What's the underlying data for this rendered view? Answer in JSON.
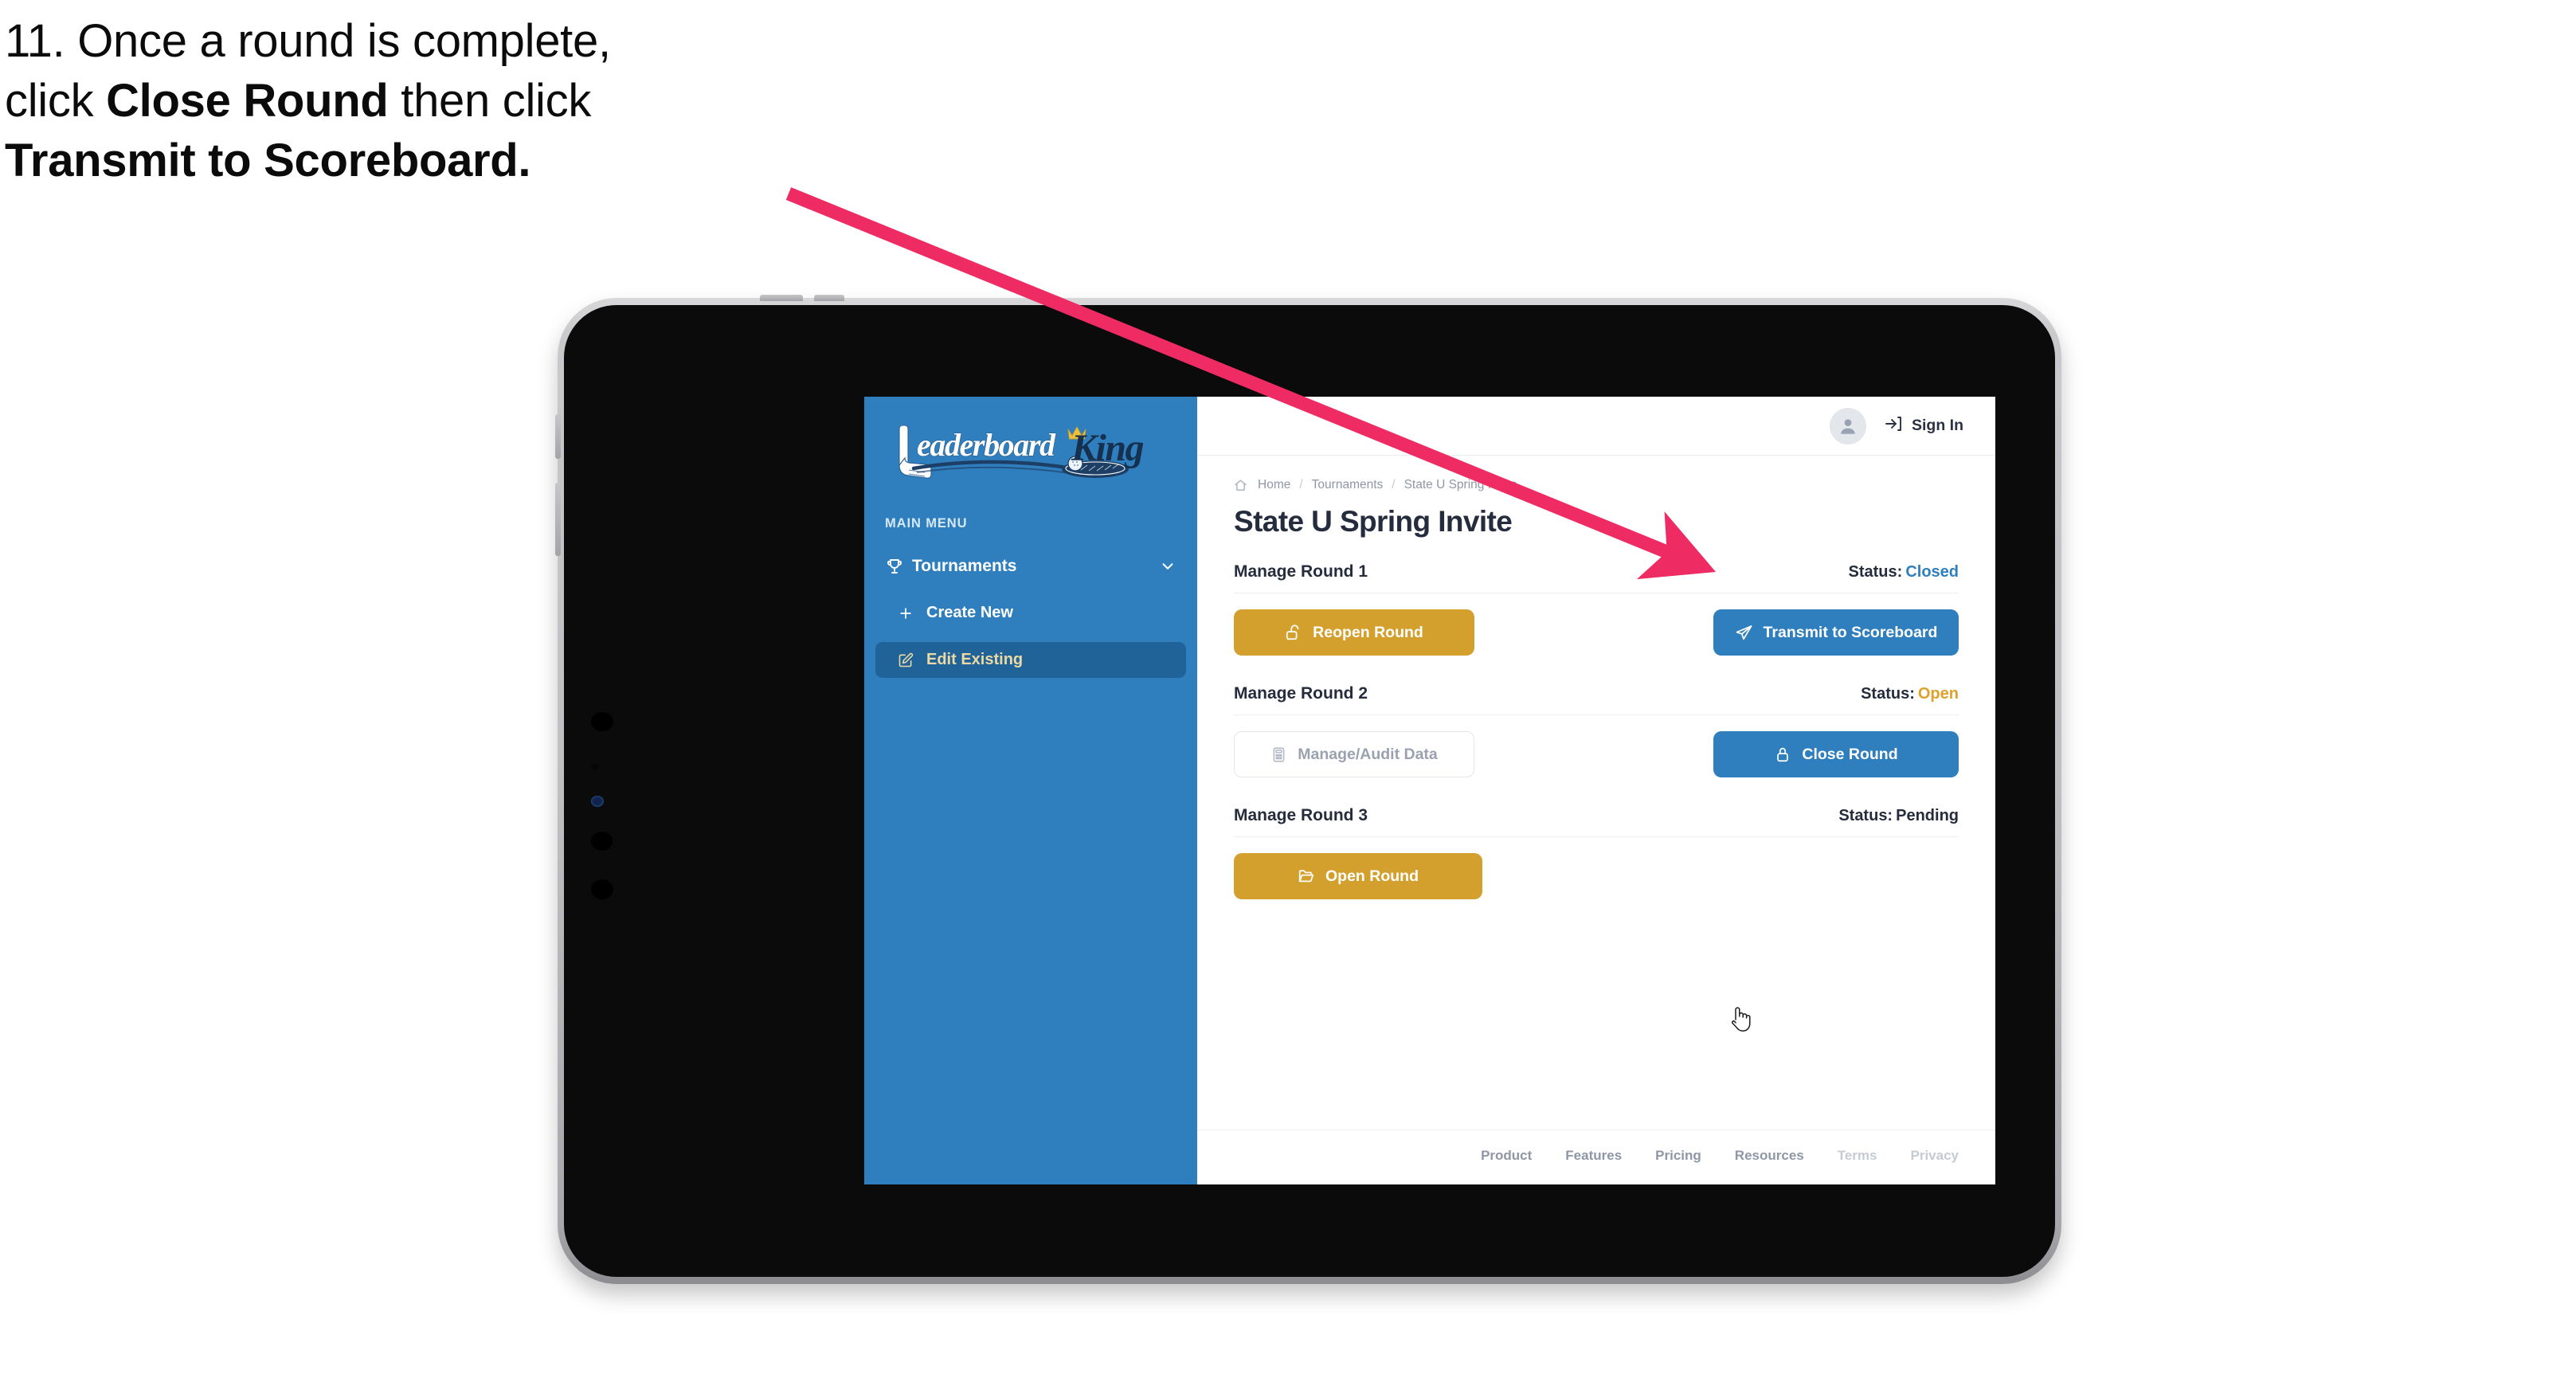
{
  "caption": {
    "line1_plain": "11. Once a round is complete,",
    "line2_pre": "click ",
    "line2_bold": "Close Round",
    "line2_post": " then click",
    "line3_bold": "Transmit to Scoreboard."
  },
  "colors": {
    "sidebar_blue": "#2f7fbe",
    "sidebar_active_blue": "#1f6399",
    "sidebar_active_text": "#ecd9a4",
    "gold": "#d3a02e",
    "blue_button": "#2f7fbe",
    "status_open": "#e0a12c",
    "status_closed": "#2f7fbe",
    "annotation_arrow": "#ef2b64",
    "text_dark": "#252c3d",
    "text_muted": "#8e97a6"
  },
  "sidebar": {
    "logo_primary": "Leaderboard",
    "logo_secondary": "King",
    "menu_label": "MAIN MENU",
    "items": [
      {
        "label": "Tournaments",
        "icon": "trophy-icon",
        "chevron": "chevron-down-icon",
        "active": false
      },
      {
        "label": "Create New",
        "icon": "plus-icon",
        "active": false
      },
      {
        "label": "Edit Existing",
        "icon": "edit-pencil-icon",
        "active": true
      }
    ]
  },
  "topbar": {
    "avatar_icon": "user-avatar-icon",
    "signin_icon": "sign-in-arrow-icon",
    "signin_label": "Sign In"
  },
  "breadcrumb": {
    "home_icon": "home-icon",
    "items": [
      "Home",
      "Tournaments",
      "State U Spring Invite"
    ],
    "separator": "/"
  },
  "page": {
    "title": "State U Spring Invite"
  },
  "rounds": [
    {
      "name": "Manage Round 1",
      "status_label": "Status:",
      "status_value": "Closed",
      "status_kind": "closed",
      "left_button": {
        "label": "Reopen Round",
        "icon": "unlock-icon",
        "style": "gold"
      },
      "right_button": {
        "label": "Transmit to Scoreboard",
        "icon": "paper-plane-icon",
        "style": "blue"
      }
    },
    {
      "name": "Manage Round 2",
      "status_label": "Status:",
      "status_value": "Open",
      "status_kind": "open",
      "left_button": {
        "label": "Manage/Audit Data",
        "icon": "calculator-icon",
        "style": "ghost"
      },
      "right_button": {
        "label": "Close Round",
        "icon": "lock-icon",
        "style": "blue"
      }
    },
    {
      "name": "Manage Round 3",
      "status_label": "Status:",
      "status_value": "Pending",
      "status_kind": "pending",
      "left_button": {
        "label": "Open Round",
        "icon": "folder-open-icon",
        "style": "gold"
      },
      "right_button": null
    }
  ],
  "footer": {
    "links": [
      {
        "label": "Product",
        "dim": false
      },
      {
        "label": "Features",
        "dim": false
      },
      {
        "label": "Pricing",
        "dim": false
      },
      {
        "label": "Resources",
        "dim": false
      },
      {
        "label": "Terms",
        "dim": true
      },
      {
        "label": "Privacy",
        "dim": true
      }
    ]
  },
  "cursor": {
    "icon": "pointing-hand-cursor"
  },
  "annotation": {
    "icon": "arrow-annotation",
    "points_to": "Transmit to Scoreboard"
  }
}
